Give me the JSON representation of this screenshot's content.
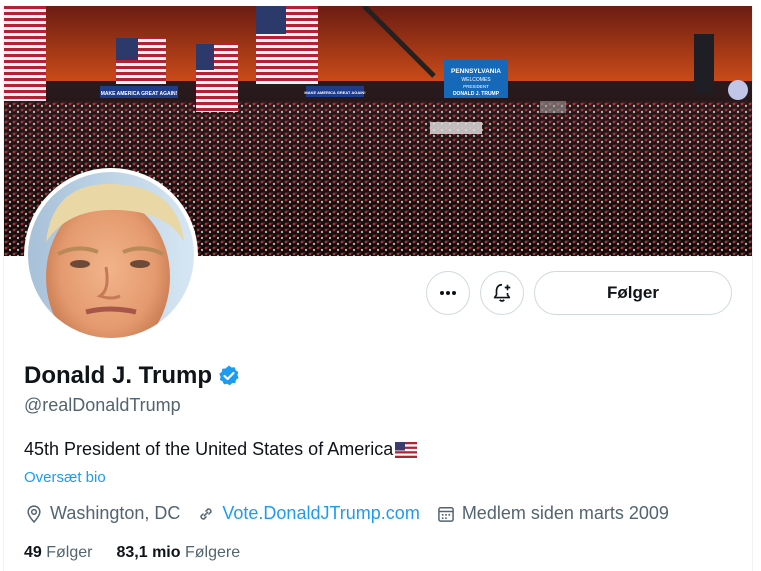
{
  "profile": {
    "name": "Donald J. Trump",
    "handle": "@realDonaldTrump",
    "bio": "45th President of the United States of America",
    "bio_flag": "us-flag-emoji",
    "translate_bio": "Oversæt bio",
    "location": "Washington, DC",
    "website": "Vote.DonaldJTrump.com",
    "joined": "Medlem siden marts 2009",
    "following_count": "49",
    "following_label": "Følger",
    "followers_count": "83,1 mio",
    "followers_label": "Følgere",
    "verified": true
  },
  "buttons": {
    "more_label": "more-options",
    "notify_label": "notifications",
    "follow_label": "Følger"
  },
  "banner": {
    "signs": [
      "MAKE AMERICA GREAT AGAIN!",
      "MAKE AMERICA GREAT AGAIN!"
    ],
    "screen_lines": [
      "PENNSYLVANIA",
      "WELCOMES",
      "PRESIDENT",
      "DONALD J. TRUMP"
    ]
  },
  "colors": {
    "accent": "#1d9bf0",
    "text": "#0f1419",
    "muted": "#536471",
    "border": "#cfd9de"
  }
}
